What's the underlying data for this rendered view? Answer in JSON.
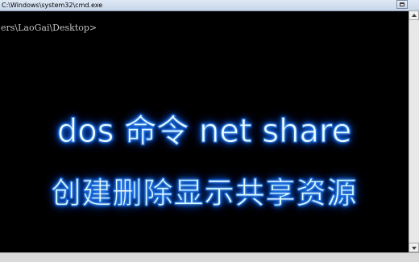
{
  "window": {
    "title": "C:\\Windows\\system32\\cmd.exe"
  },
  "console": {
    "prompt": "ers\\LaoGai\\Desktop>"
  },
  "overlay": {
    "line1": "dos 命令 net share",
    "line2": "创建删除显示共享资源"
  },
  "colors": {
    "console_background": "#000000",
    "console_text": "#c0c0c0",
    "overlay_text": "#ffffff",
    "overlay_glow": "#1e7dff"
  },
  "icons": {
    "scroll_up": "triangle-up-icon",
    "scroll_down": "triangle-down-icon",
    "maximize": "maximize-icon"
  }
}
